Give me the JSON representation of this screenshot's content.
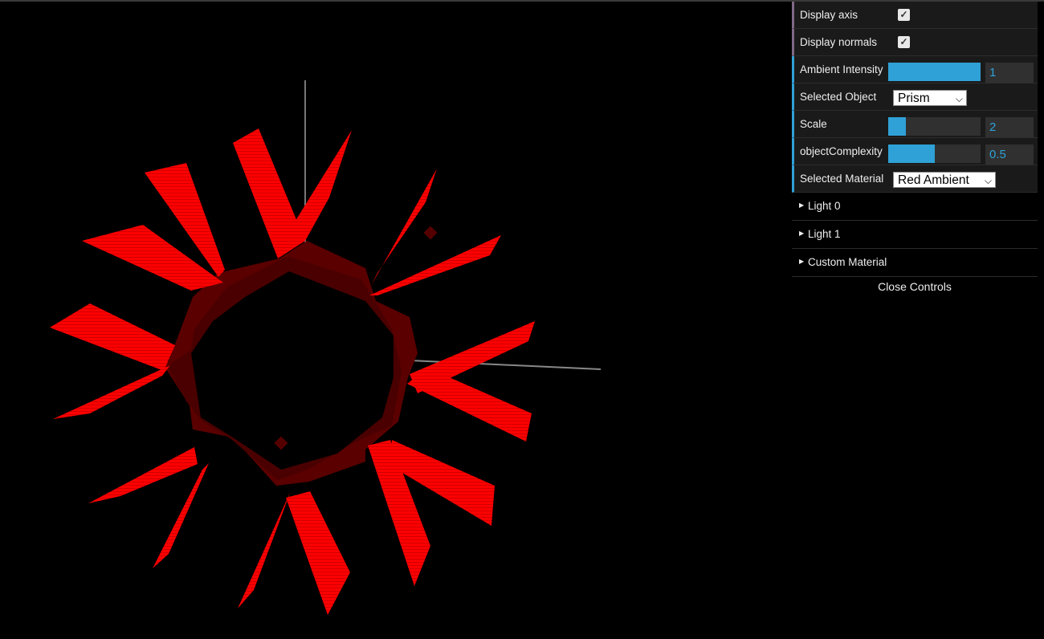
{
  "controls": {
    "display_axis": {
      "label": "Display axis",
      "checked": true
    },
    "display_normals": {
      "label": "Display normals",
      "checked": true
    },
    "ambient_intensity": {
      "label": "Ambient Intensity",
      "value": "1",
      "fill": 1.0
    },
    "selected_object": {
      "label": "Selected Object",
      "value": "Prism"
    },
    "scale": {
      "label": "Scale",
      "value": "2",
      "fill": 0.19
    },
    "object_complexity": {
      "label": "objectComplexity",
      "value": "0.5",
      "fill": 0.5
    },
    "selected_material": {
      "label": "Selected Material",
      "value": "Red Ambient"
    }
  },
  "folders": [
    {
      "label": "Light 0"
    },
    {
      "label": "Light 1"
    },
    {
      "label": "Custom Material"
    }
  ],
  "close_label": "Close Controls",
  "colors": {
    "accent": "#2fa1d6",
    "object_red": "#ff0000",
    "ring_dark_red": "#4a0000",
    "axis_gray": "#666666"
  },
  "icons": {
    "checkbox": "check-icon",
    "folder": "triangle-right-icon",
    "dropdown": "chevron-down-icon"
  }
}
